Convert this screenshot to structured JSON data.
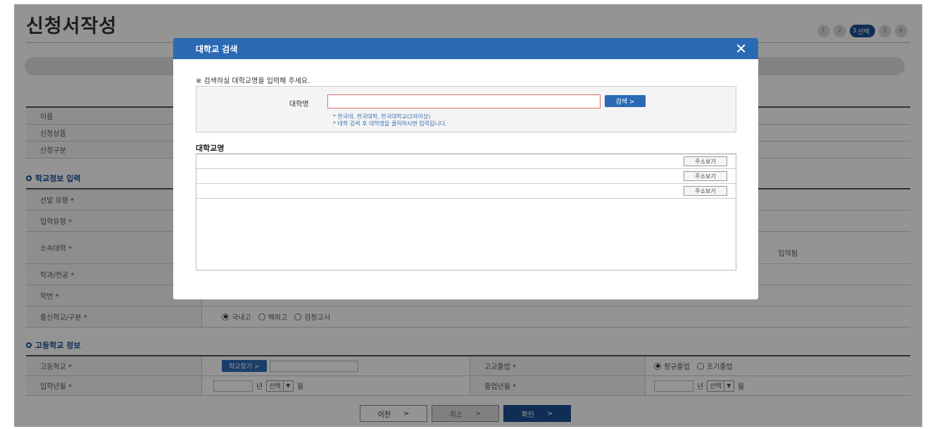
{
  "page": {
    "title": "신청서작성",
    "steps": [
      "1",
      "2",
      "3",
      "5",
      "6"
    ],
    "active_step_sub": "선택"
  },
  "applicant_table": {
    "rows": [
      "이름",
      "신청상품",
      "신청구분"
    ]
  },
  "school_section": {
    "title": "학교정보 입력",
    "rows": [
      "선발 유형 *",
      "입학유형 *",
      "소속대학 *",
      "학과/전공 *",
      "학번 *",
      "출신학교/구분 *"
    ],
    "input_hint_tail": "입력됨",
    "origin_options": [
      "국내고",
      "해외고",
      "검정고시"
    ]
  },
  "highschool_section": {
    "title": "고등학교 정보",
    "school_label": "고등학교 *",
    "find_button": "학교찾기 >",
    "grad_label": "고교졸업 *",
    "grad_options": [
      "정규졸업",
      "조기졸업"
    ],
    "entry_label": "입학년월 *",
    "year_unit": "년",
    "month_select": "선택",
    "month_unit": "월",
    "grad_date_label": "졸업년월 *"
  },
  "bottom_buttons": {
    "prev": "이전",
    "cancel": "취소",
    "confirm": "확인",
    "arrow": ">"
  },
  "modal": {
    "title": "대학교 검색",
    "instruction": "※ 검색하실 대학교명을 입력해 주세요.",
    "field_label": "대학명",
    "field_value": "",
    "search_button": "검색 >",
    "note_1": "* 한국대, 한국대학, 한국대학교(2자이상)",
    "note_2": "* 대학 검색 후 대학명을 클릭하시면 입력됩니다.",
    "list_title": "대학교명",
    "results": [
      {
        "name": "",
        "button": "주소보기"
      },
      {
        "name": "",
        "button": "주소보기"
      },
      {
        "name": "",
        "button": "주소보기"
      }
    ]
  }
}
